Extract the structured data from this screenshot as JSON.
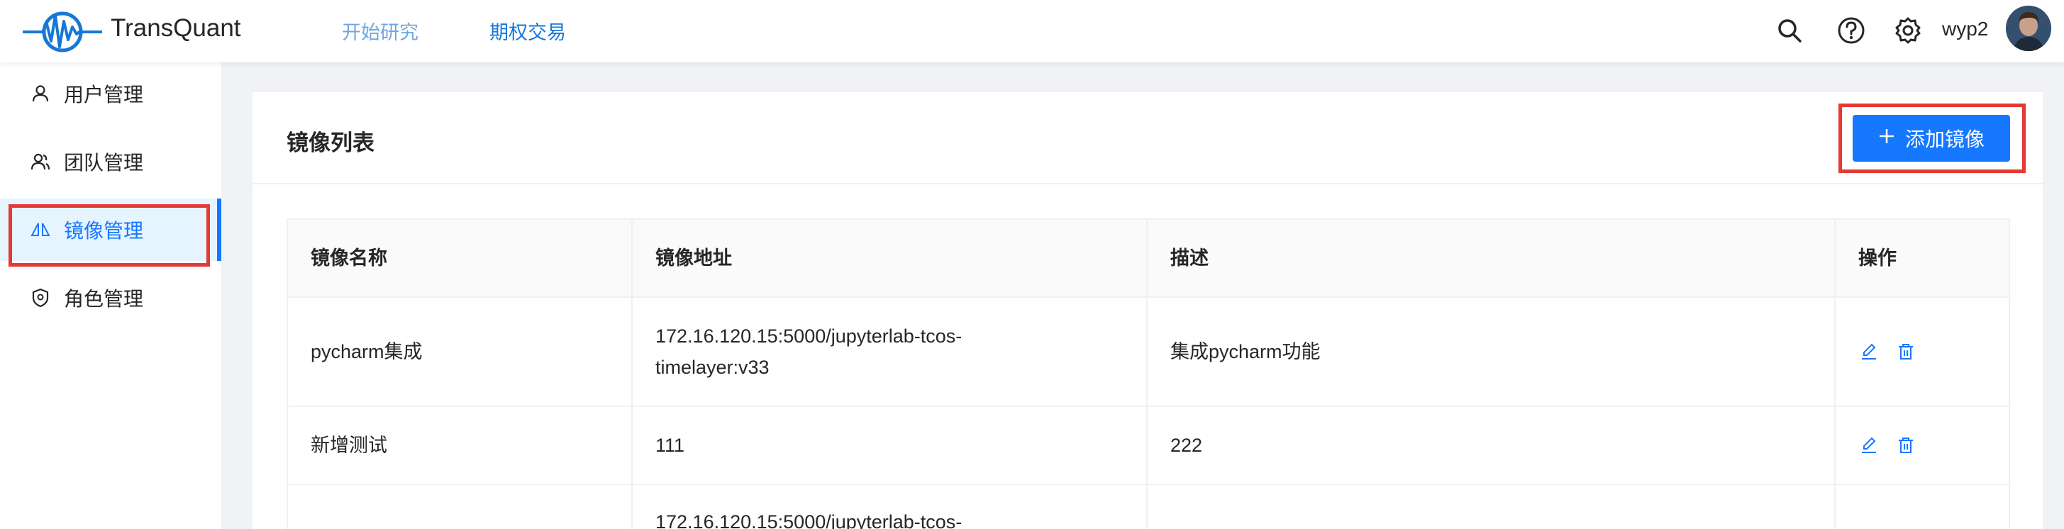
{
  "app": {
    "title": "TransQuant"
  },
  "topnav": {
    "items": [
      {
        "label": "开始研究"
      },
      {
        "label": "期权交易"
      }
    ]
  },
  "header": {
    "username": "wyp2"
  },
  "sidebar": {
    "items": [
      {
        "label": "用户管理",
        "icon": "user-icon"
      },
      {
        "label": "团队管理",
        "icon": "team-icon"
      },
      {
        "label": "镜像管理",
        "icon": "image-icon",
        "active": true
      },
      {
        "label": "角色管理",
        "icon": "role-shield-icon"
      }
    ]
  },
  "main": {
    "title": "镜像列表",
    "add_button": "添加镜像",
    "table": {
      "columns": [
        "镜像名称",
        "镜像地址",
        "描述",
        "操作"
      ],
      "rows": [
        {
          "name": "pycharm集成",
          "address_line1": "172.16.120.15:5000/jupyterlab-tcos-",
          "address_line2": "timelayer:v33",
          "description": "集成pycharm功能"
        },
        {
          "name": "新增测试",
          "address_line1": "111",
          "address_line2": "",
          "description": "222"
        },
        {
          "name": "",
          "address_line1": "172.16.120.15:5000/jupyterlab-tcos-",
          "address_line2": "",
          "description": ""
        }
      ]
    }
  },
  "colors": {
    "primary": "#1677ff",
    "highlight_box": "#e53935",
    "active_bg": "#e6f4ff"
  }
}
